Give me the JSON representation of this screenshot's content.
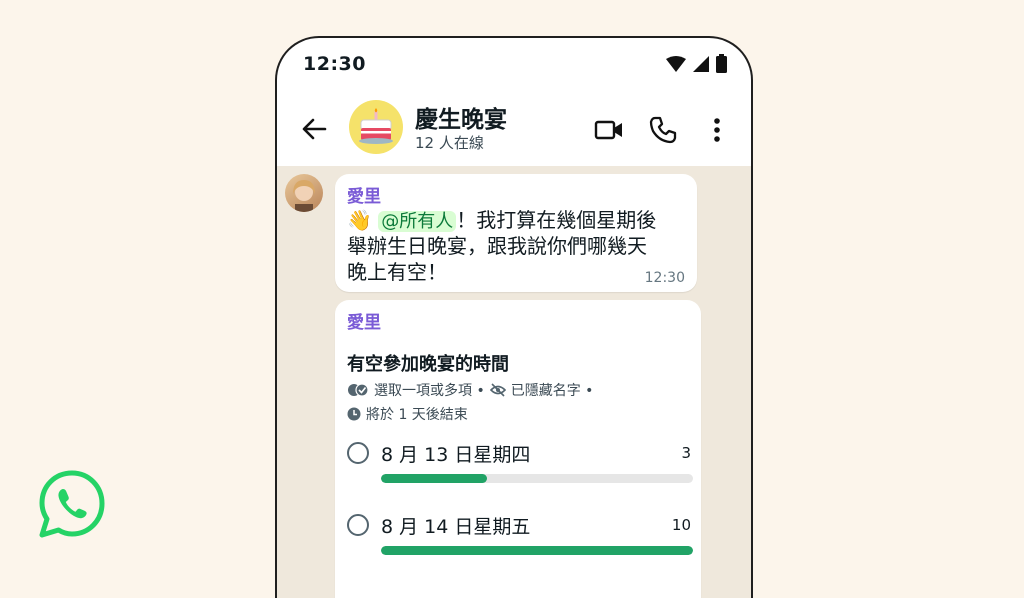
{
  "status_bar": {
    "time": "12:30"
  },
  "header": {
    "title": "慶生晚宴",
    "subtitle": "12 人在線",
    "group_avatar_icon": "birthday-cake-icon"
  },
  "message": {
    "sender": "愛里",
    "wave_icon": "👋",
    "mention": "@所有人",
    "line1_rest": "！我打算在幾個星期後",
    "line2": "舉辦生日晚宴，跟我說你們哪幾天",
    "line3": "晚上有空！",
    "time": "12:30"
  },
  "poll": {
    "sender": "愛里",
    "title": "有空參加晚宴的時間",
    "meta_select": "選取一項或多項 •",
    "meta_hidden": "已隱藏名字 •",
    "meta_end": "將於 1 天後結束",
    "options": [
      {
        "label": "8 月 13 日星期四",
        "count": "3",
        "fill": 0.34
      },
      {
        "label": "8 月 14 日星期五",
        "count": "10",
        "fill": 1.0
      }
    ]
  },
  "colors": {
    "accent_green": "#21a366",
    "sender_purple": "#7a5bd6",
    "background": "#fcf5eb"
  }
}
